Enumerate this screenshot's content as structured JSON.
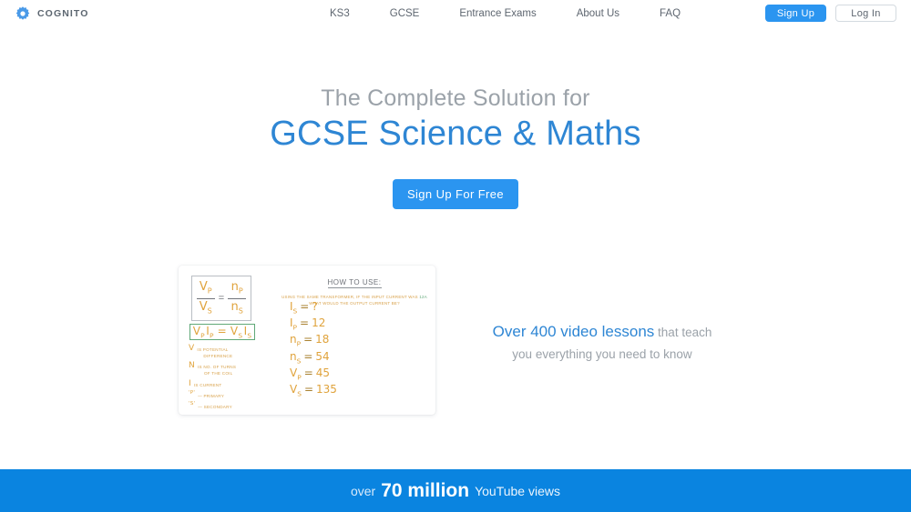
{
  "header": {
    "brand": {
      "name": "COGNITO",
      "icon": "gear-icon"
    },
    "nav": [
      {
        "label": "KS3"
      },
      {
        "label": "GCSE"
      },
      {
        "label": "Entrance Exams"
      },
      {
        "label": "About Us"
      },
      {
        "label": "FAQ"
      }
    ],
    "signup_label": "Sign Up",
    "login_label": "Log In"
  },
  "hero": {
    "subtitle": "The Complete Solution for",
    "title": "GCSE Science & Maths",
    "cta_label": "Sign Up For Free"
  },
  "board": {
    "formula_main": {
      "num_left": "V",
      "num_left_sub": "P",
      "den_left": "V",
      "den_left_sub": "S",
      "equals": "=",
      "num_right": "n",
      "num_right_sub": "P",
      "den_right": "n",
      "den_right_sub": "S"
    },
    "formula_boxed": "Vₚ Iₚ = Vₛ Iₛ",
    "legend": [
      {
        "symbol": "V",
        "text": "IS POTENTIAL",
        "text2": "DIFFERENCE"
      },
      {
        "symbol": "n",
        "text": "IS NO. OF TURNS",
        "text2": "OF THE COIL"
      },
      {
        "symbol": "I",
        "text": "IS CURRENT",
        "text2": ""
      },
      {
        "symbol": "'P'",
        "text": "— PRIMARY",
        "text2": ""
      },
      {
        "symbol": "'S'",
        "text": "— SECONDARY",
        "text2": ""
      }
    ],
    "howto_title": "HOW TO USE:",
    "question_line1": "USING THE SAME TRANSFORMER, IF THE INPUT CURRENT WAS",
    "question_highlight": "12A",
    "question_line2": "WHAT WOULD THE OUTPUT CURRENT BE?",
    "values": [
      {
        "symbol": "I",
        "sub": "S",
        "value": "?"
      },
      {
        "symbol": "I",
        "sub": "P",
        "value": "12"
      },
      {
        "symbol": "n",
        "sub": "P",
        "value": "18"
      },
      {
        "symbol": "n",
        "sub": "S",
        "value": "54"
      },
      {
        "symbol": "V",
        "sub": "P",
        "value": "45"
      },
      {
        "symbol": "V",
        "sub": "S",
        "value": "135"
      }
    ]
  },
  "tagline": {
    "highlight": "Over 400 video lessons",
    "rest_line1": " that teach",
    "rest_line2": "you everything you need to know"
  },
  "banner": {
    "prefix": "over",
    "number": "70 million",
    "suffix": "YouTube views"
  },
  "colors": {
    "brand_blue": "#2b95f0",
    "title_blue": "#2e86d4",
    "banner_blue": "#0a84e0",
    "board_orange": "#e0a33c",
    "board_green": "#5fa877",
    "muted_gray": "#9ba2a9"
  }
}
